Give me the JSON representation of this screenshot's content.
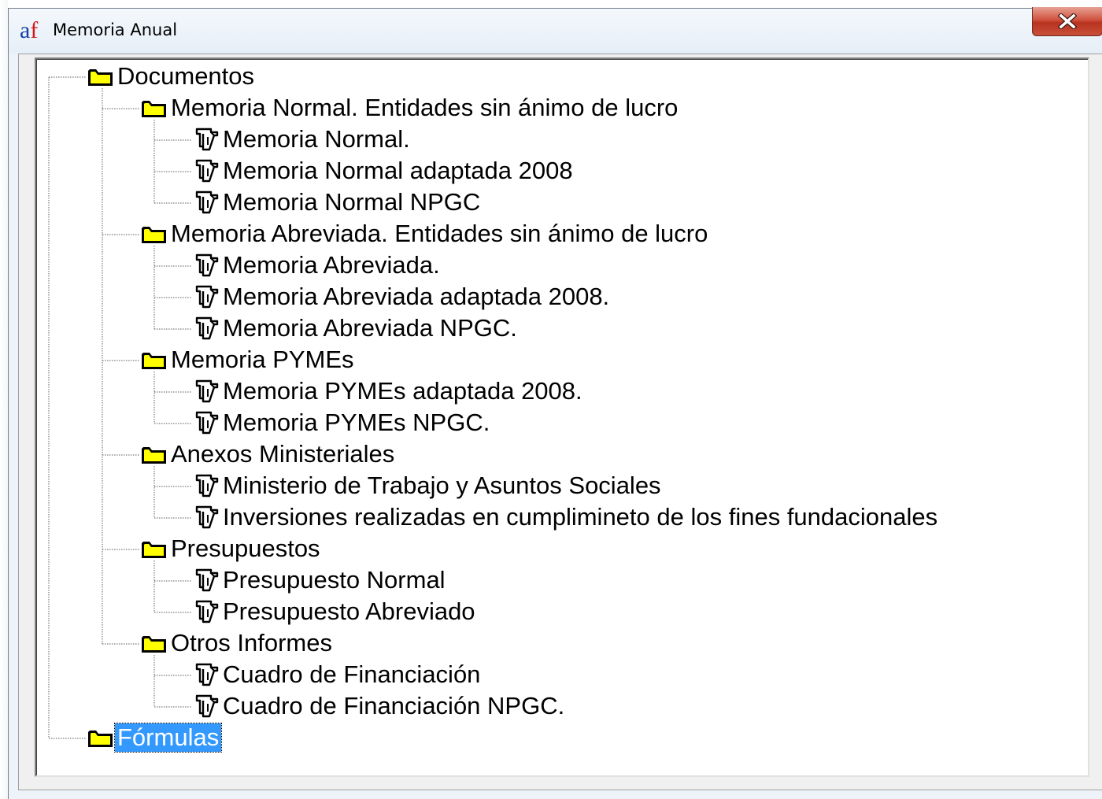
{
  "window": {
    "title": "Memoria Anual",
    "icon_letters": {
      "a": "a",
      "f": "f"
    },
    "close_symbol": "close-icon"
  },
  "colors": {
    "folder_fill": "#ffff00",
    "selection": "#3399ff",
    "close_button": "#c9503a",
    "icon_a": "#123ea8",
    "icon_f": "#d11818"
  },
  "tree": {
    "root": {
      "label": "Documentos",
      "icon": "folder-icon"
    },
    "folders": [
      {
        "label": "Memoria Normal. Entidades sin ánimo de lucro",
        "icon": "folder-icon",
        "items": [
          "Memoria Normal.",
          "Memoria Normal adaptada 2008",
          "Memoria Normal NPGC"
        ]
      },
      {
        "label": "Memoria Abreviada. Entidades sin ánimo de lucro",
        "icon": "folder-icon",
        "items": [
          "Memoria Abreviada.",
          "Memoria Abreviada adaptada 2008.",
          "Memoria Abreviada NPGC."
        ]
      },
      {
        "label": "Memoria PYMEs",
        "icon": "folder-icon",
        "items": [
          "Memoria PYMEs adaptada 2008.",
          "Memoria PYMEs NPGC."
        ]
      },
      {
        "label": "Anexos Ministeriales",
        "icon": "folder-icon",
        "items": [
          "Ministerio de Trabajo y Asuntos Sociales",
          "Inversiones realizadas en cumplimineto de los fines fundacionales"
        ]
      },
      {
        "label": "Presupuestos",
        "icon": "folder-icon",
        "items": [
          "Presupuesto Normal",
          "Presupuesto Abreviado"
        ]
      },
      {
        "label": "Otros Informes",
        "icon": "folder-icon",
        "items": [
          "Cuadro de Financiación",
          "Cuadro de Financiación NPGC."
        ]
      }
    ],
    "root2": {
      "label": "Fórmulas",
      "icon": "folder-icon",
      "selected": true
    },
    "document_icon": "document-icon"
  }
}
